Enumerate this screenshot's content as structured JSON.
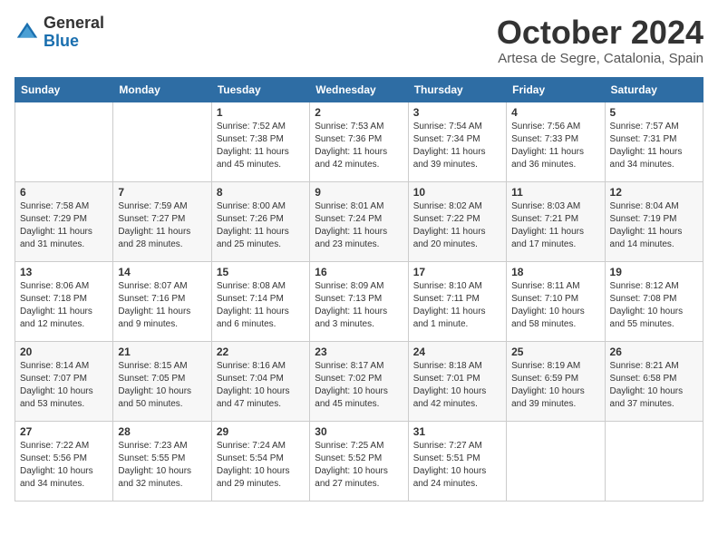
{
  "header": {
    "logo_general": "General",
    "logo_blue": "Blue",
    "month": "October 2024",
    "location": "Artesa de Segre, Catalonia, Spain"
  },
  "weekdays": [
    "Sunday",
    "Monday",
    "Tuesday",
    "Wednesday",
    "Thursday",
    "Friday",
    "Saturday"
  ],
  "weeks": [
    [
      {
        "day": "",
        "info": ""
      },
      {
        "day": "",
        "info": ""
      },
      {
        "day": "1",
        "info": "Sunrise: 7:52 AM\nSunset: 7:38 PM\nDaylight: 11 hours and 45 minutes."
      },
      {
        "day": "2",
        "info": "Sunrise: 7:53 AM\nSunset: 7:36 PM\nDaylight: 11 hours and 42 minutes."
      },
      {
        "day": "3",
        "info": "Sunrise: 7:54 AM\nSunset: 7:34 PM\nDaylight: 11 hours and 39 minutes."
      },
      {
        "day": "4",
        "info": "Sunrise: 7:56 AM\nSunset: 7:33 PM\nDaylight: 11 hours and 36 minutes."
      },
      {
        "day": "5",
        "info": "Sunrise: 7:57 AM\nSunset: 7:31 PM\nDaylight: 11 hours and 34 minutes."
      }
    ],
    [
      {
        "day": "6",
        "info": "Sunrise: 7:58 AM\nSunset: 7:29 PM\nDaylight: 11 hours and 31 minutes."
      },
      {
        "day": "7",
        "info": "Sunrise: 7:59 AM\nSunset: 7:27 PM\nDaylight: 11 hours and 28 minutes."
      },
      {
        "day": "8",
        "info": "Sunrise: 8:00 AM\nSunset: 7:26 PM\nDaylight: 11 hours and 25 minutes."
      },
      {
        "day": "9",
        "info": "Sunrise: 8:01 AM\nSunset: 7:24 PM\nDaylight: 11 hours and 23 minutes."
      },
      {
        "day": "10",
        "info": "Sunrise: 8:02 AM\nSunset: 7:22 PM\nDaylight: 11 hours and 20 minutes."
      },
      {
        "day": "11",
        "info": "Sunrise: 8:03 AM\nSunset: 7:21 PM\nDaylight: 11 hours and 17 minutes."
      },
      {
        "day": "12",
        "info": "Sunrise: 8:04 AM\nSunset: 7:19 PM\nDaylight: 11 hours and 14 minutes."
      }
    ],
    [
      {
        "day": "13",
        "info": "Sunrise: 8:06 AM\nSunset: 7:18 PM\nDaylight: 11 hours and 12 minutes."
      },
      {
        "day": "14",
        "info": "Sunrise: 8:07 AM\nSunset: 7:16 PM\nDaylight: 11 hours and 9 minutes."
      },
      {
        "day": "15",
        "info": "Sunrise: 8:08 AM\nSunset: 7:14 PM\nDaylight: 11 hours and 6 minutes."
      },
      {
        "day": "16",
        "info": "Sunrise: 8:09 AM\nSunset: 7:13 PM\nDaylight: 11 hours and 3 minutes."
      },
      {
        "day": "17",
        "info": "Sunrise: 8:10 AM\nSunset: 7:11 PM\nDaylight: 11 hours and 1 minute."
      },
      {
        "day": "18",
        "info": "Sunrise: 8:11 AM\nSunset: 7:10 PM\nDaylight: 10 hours and 58 minutes."
      },
      {
        "day": "19",
        "info": "Sunrise: 8:12 AM\nSunset: 7:08 PM\nDaylight: 10 hours and 55 minutes."
      }
    ],
    [
      {
        "day": "20",
        "info": "Sunrise: 8:14 AM\nSunset: 7:07 PM\nDaylight: 10 hours and 53 minutes."
      },
      {
        "day": "21",
        "info": "Sunrise: 8:15 AM\nSunset: 7:05 PM\nDaylight: 10 hours and 50 minutes."
      },
      {
        "day": "22",
        "info": "Sunrise: 8:16 AM\nSunset: 7:04 PM\nDaylight: 10 hours and 47 minutes."
      },
      {
        "day": "23",
        "info": "Sunrise: 8:17 AM\nSunset: 7:02 PM\nDaylight: 10 hours and 45 minutes."
      },
      {
        "day": "24",
        "info": "Sunrise: 8:18 AM\nSunset: 7:01 PM\nDaylight: 10 hours and 42 minutes."
      },
      {
        "day": "25",
        "info": "Sunrise: 8:19 AM\nSunset: 6:59 PM\nDaylight: 10 hours and 39 minutes."
      },
      {
        "day": "26",
        "info": "Sunrise: 8:21 AM\nSunset: 6:58 PM\nDaylight: 10 hours and 37 minutes."
      }
    ],
    [
      {
        "day": "27",
        "info": "Sunrise: 7:22 AM\nSunset: 5:56 PM\nDaylight: 10 hours and 34 minutes."
      },
      {
        "day": "28",
        "info": "Sunrise: 7:23 AM\nSunset: 5:55 PM\nDaylight: 10 hours and 32 minutes."
      },
      {
        "day": "29",
        "info": "Sunrise: 7:24 AM\nSunset: 5:54 PM\nDaylight: 10 hours and 29 minutes."
      },
      {
        "day": "30",
        "info": "Sunrise: 7:25 AM\nSunset: 5:52 PM\nDaylight: 10 hours and 27 minutes."
      },
      {
        "day": "31",
        "info": "Sunrise: 7:27 AM\nSunset: 5:51 PM\nDaylight: 10 hours and 24 minutes."
      },
      {
        "day": "",
        "info": ""
      },
      {
        "day": "",
        "info": ""
      }
    ]
  ]
}
